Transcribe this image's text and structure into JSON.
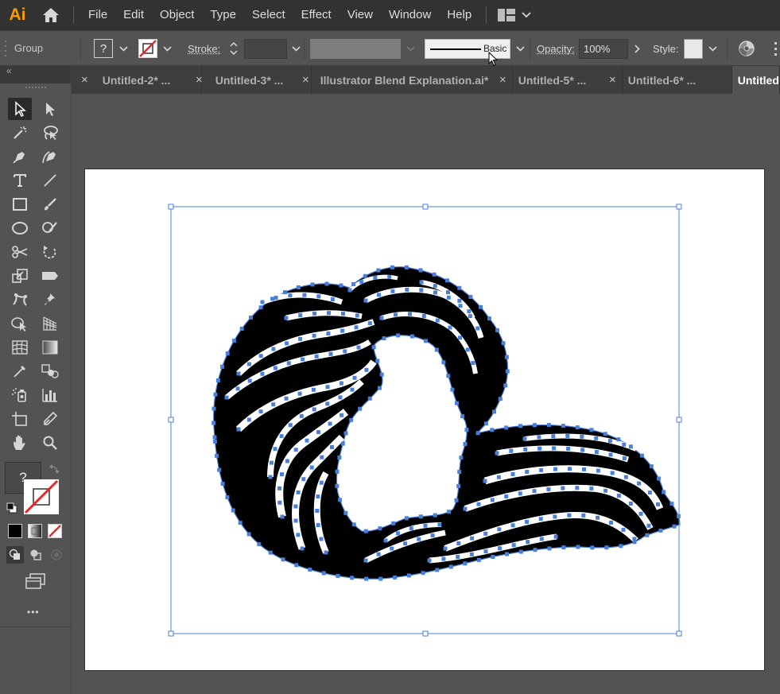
{
  "app": {
    "logo": "Ai"
  },
  "menu": {
    "items": [
      "File",
      "Edit",
      "Object",
      "Type",
      "Select",
      "Effect",
      "View",
      "Window",
      "Help"
    ]
  },
  "control_bar": {
    "selection_label": "Group",
    "fill_swatch_glyph": "?",
    "stroke_label": "Stroke:",
    "brush_label": "Basic",
    "opacity_label": "Opacity:",
    "opacity_value": "100%",
    "style_label": "Style:"
  },
  "tabs": [
    {
      "label": "Untitled-2* ..."
    },
    {
      "label": "Untitled-3* ..."
    },
    {
      "label": "Illustrator Blend Explanation.ai*"
    },
    {
      "label": "Untitled-5* ..."
    },
    {
      "label": "Untitled-6* ..."
    },
    {
      "label": "Untitled"
    }
  ],
  "tab_close_glyph": "×",
  "toolbar": {
    "collapse_glyph": "«",
    "fill_unknown_glyph": "?",
    "more_glyph": "•••"
  },
  "colors": {
    "accent": "#ff9a00",
    "selection_blue": "#4a7fd8",
    "artwork": "#000000",
    "none_red": "#e8262a"
  },
  "icons": [
    "home-icon",
    "workspace-icon",
    "selection-tool-icon",
    "direct-selection-tool-icon",
    "magic-wand-icon",
    "lasso-icon",
    "pen-tool-icon",
    "curvature-tool-icon",
    "type-tool-icon",
    "line-tool-icon",
    "rectangle-tool-icon",
    "paintbrush-icon",
    "ellipse-tool-icon",
    "shaper-tool-icon",
    "scissors-icon",
    "rotate-tool-icon",
    "scale-tool-icon",
    "width-tool-icon",
    "puppet-warp-icon",
    "pin-icon",
    "shape-builder-icon",
    "perspective-grid-icon",
    "mesh-tool-icon",
    "gradient-tool-icon",
    "eyedropper-icon",
    "blend-tool-icon",
    "symbol-sprayer-icon",
    "graph-tool-icon",
    "artboard-tool-icon",
    "slice-tool-icon",
    "hand-tool-icon",
    "zoom-tool-icon"
  ]
}
